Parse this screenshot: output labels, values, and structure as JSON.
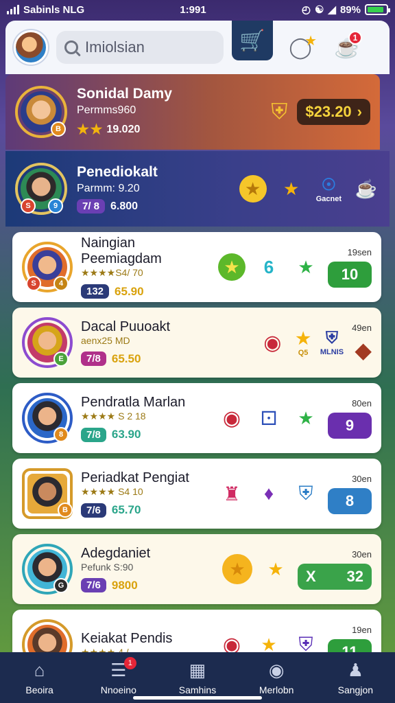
{
  "status_bar": {
    "carrier": "Sabinls NLG",
    "time": "1:991",
    "battery_text": "89%",
    "battery_fill": 0.9
  },
  "header": {
    "search_placeholder": "Imiolsian",
    "notification_count": "1"
  },
  "featured": [
    {
      "name": "Sonidal Damy",
      "subtitle": "Permms960",
      "points": "19.020",
      "amount": "$23.20",
      "colors": {
        "bg": "#a3563f"
      }
    },
    {
      "name": "Penediokalt",
      "subtitle": "Parmm: 9.20",
      "tag": "7/ 8",
      "points": "6.800",
      "action_label": "Gacnet"
    }
  ],
  "cards": [
    {
      "name": "Naingian Peemiagdam",
      "stars_text": "★★★★S4/ 70",
      "tag": "132",
      "value": "65.90",
      "time": "19sen",
      "score": "10",
      "score_color": "#2e9e3c",
      "style": "white"
    },
    {
      "name": "Dacal Puuoakt",
      "stars_text": "aenx25 MD",
      "tag": "7/8",
      "value": "65.50",
      "time": "49en",
      "icon_label": "Q5",
      "icon_label2": "MLNIS",
      "score": "",
      "style": "cream"
    },
    {
      "name": "Pendratla Marlan",
      "stars_text": "★★★★ S 2 18",
      "tag": "7/8",
      "value": "63.90",
      "time": "80en",
      "score": "9",
      "score_color": "#6a2fae",
      "style": "white"
    },
    {
      "name": "Periadkat Pengiat",
      "stars_text": "★★★★ S4 10",
      "tag": "7/6",
      "value": "65.70",
      "time": "30en",
      "score": "8",
      "score_color": "#2f7fc6",
      "style": "white"
    },
    {
      "name": "Adegdaniet",
      "stars_text": "Pefunk S:90",
      "tag": "7/6",
      "value": "9800",
      "time": "30en",
      "score": "32",
      "score_prefix": "X",
      "score_color": "#3aa34a",
      "style": "cream"
    },
    {
      "name": "Keiakat Pendis",
      "stars_text": "★★★★ 4 /",
      "tag": "",
      "value": "",
      "time": "19en",
      "score": "11",
      "score_color": "#2e9e3c",
      "style": "white"
    }
  ],
  "bottom_nav": [
    {
      "label": "Beoira",
      "icon": "home-icon"
    },
    {
      "label": "Nnoeino",
      "icon": "news-icon",
      "badge": "1"
    },
    {
      "label": "Samhins",
      "icon": "chart-icon"
    },
    {
      "label": "Merlobn",
      "icon": "chat-icon"
    },
    {
      "label": "Sangjon",
      "icon": "profile-icon"
    }
  ]
}
